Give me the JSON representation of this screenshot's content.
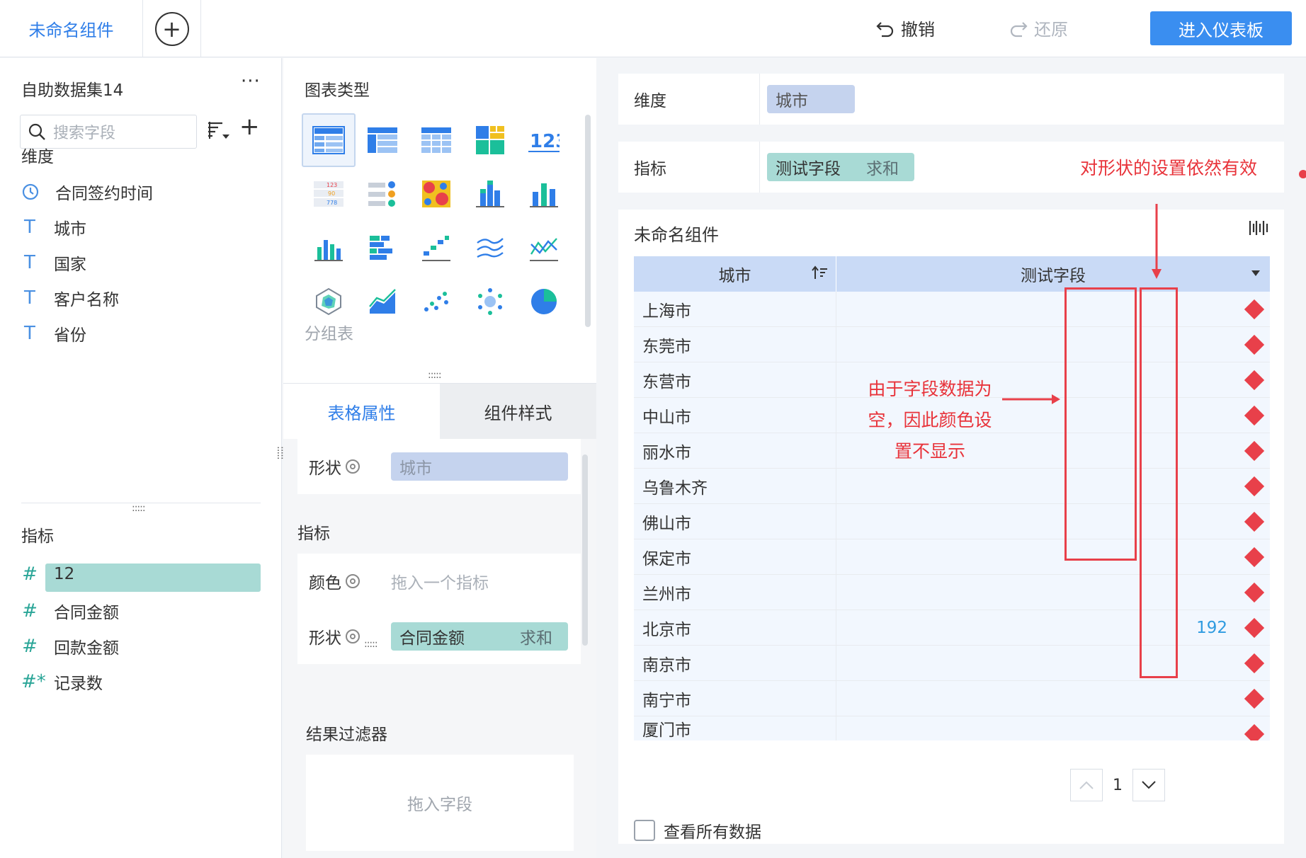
{
  "topbar": {
    "tab_title": "未命名组件",
    "undo_label": "撤销",
    "redo_label": "还原",
    "enter_label": "进入仪表板"
  },
  "left": {
    "dataset_title": "自助数据集14",
    "more": "···",
    "search_placeholder": "搜索字段",
    "dim_label": "维度",
    "dimensions": [
      {
        "icon": "clock-icon",
        "label": "合同签约时间"
      },
      {
        "icon": "text-type-icon",
        "label": "城市"
      },
      {
        "icon": "text-type-icon",
        "label": "国家"
      },
      {
        "icon": "text-type-icon",
        "label": "客户名称"
      },
      {
        "icon": "text-type-icon",
        "label": "省份"
      }
    ],
    "measure_label": "指标",
    "measures": [
      {
        "icon": "number-type-icon",
        "label": "12"
      },
      {
        "icon": "number-type-icon",
        "label": "合同金额"
      },
      {
        "icon": "number-type-icon",
        "label": "回款金额"
      },
      {
        "icon": "count-type-icon",
        "label": "记录数"
      }
    ]
  },
  "mid": {
    "chart_type_title": "图表类型",
    "chart_type_selected_label": "分组表",
    "tabs": [
      "表格属性",
      "组件样式"
    ],
    "shape_label": "形状",
    "shape_dim_value": "城市",
    "measure_label": "指标",
    "color_label": "颜色",
    "color_placeholder": "拖入一个指标",
    "shape2_label": "形状",
    "shape2_field": "合同金额",
    "shape2_agg": "求和",
    "result_filter_label": "结果过滤器",
    "filter_placeholder": "拖入字段"
  },
  "right": {
    "dim_shelf_label": "维度",
    "dim_shelf_value": "城市",
    "measure_shelf_label": "指标",
    "measure_shelf_field": "测试字段",
    "measure_shelf_agg": "求和",
    "annotation_top": "对形状的设置依然有效",
    "annotation_mid": [
      "由于字段数据为",
      "空，因此颜色设",
      "置不显示"
    ],
    "widget_title": "未命名组件",
    "table": {
      "columns": [
        "城市",
        "测试字段"
      ],
      "rows": [
        {
          "city": "上海市",
          "value": ""
        },
        {
          "city": "东莞市",
          "value": ""
        },
        {
          "city": "东营市",
          "value": ""
        },
        {
          "city": "中山市",
          "value": ""
        },
        {
          "city": "丽水市",
          "value": ""
        },
        {
          "city": "乌鲁木齐",
          "value": ""
        },
        {
          "city": "佛山市",
          "value": ""
        },
        {
          "city": "保定市",
          "value": ""
        },
        {
          "city": "兰州市",
          "value": ""
        },
        {
          "city": "北京市",
          "value": "192"
        },
        {
          "city": "南京市",
          "value": ""
        },
        {
          "city": "南宁市",
          "value": ""
        },
        {
          "city": "厦门市",
          "value": ""
        }
      ]
    },
    "page_number": "1",
    "view_all_label": "查看所有数据"
  }
}
